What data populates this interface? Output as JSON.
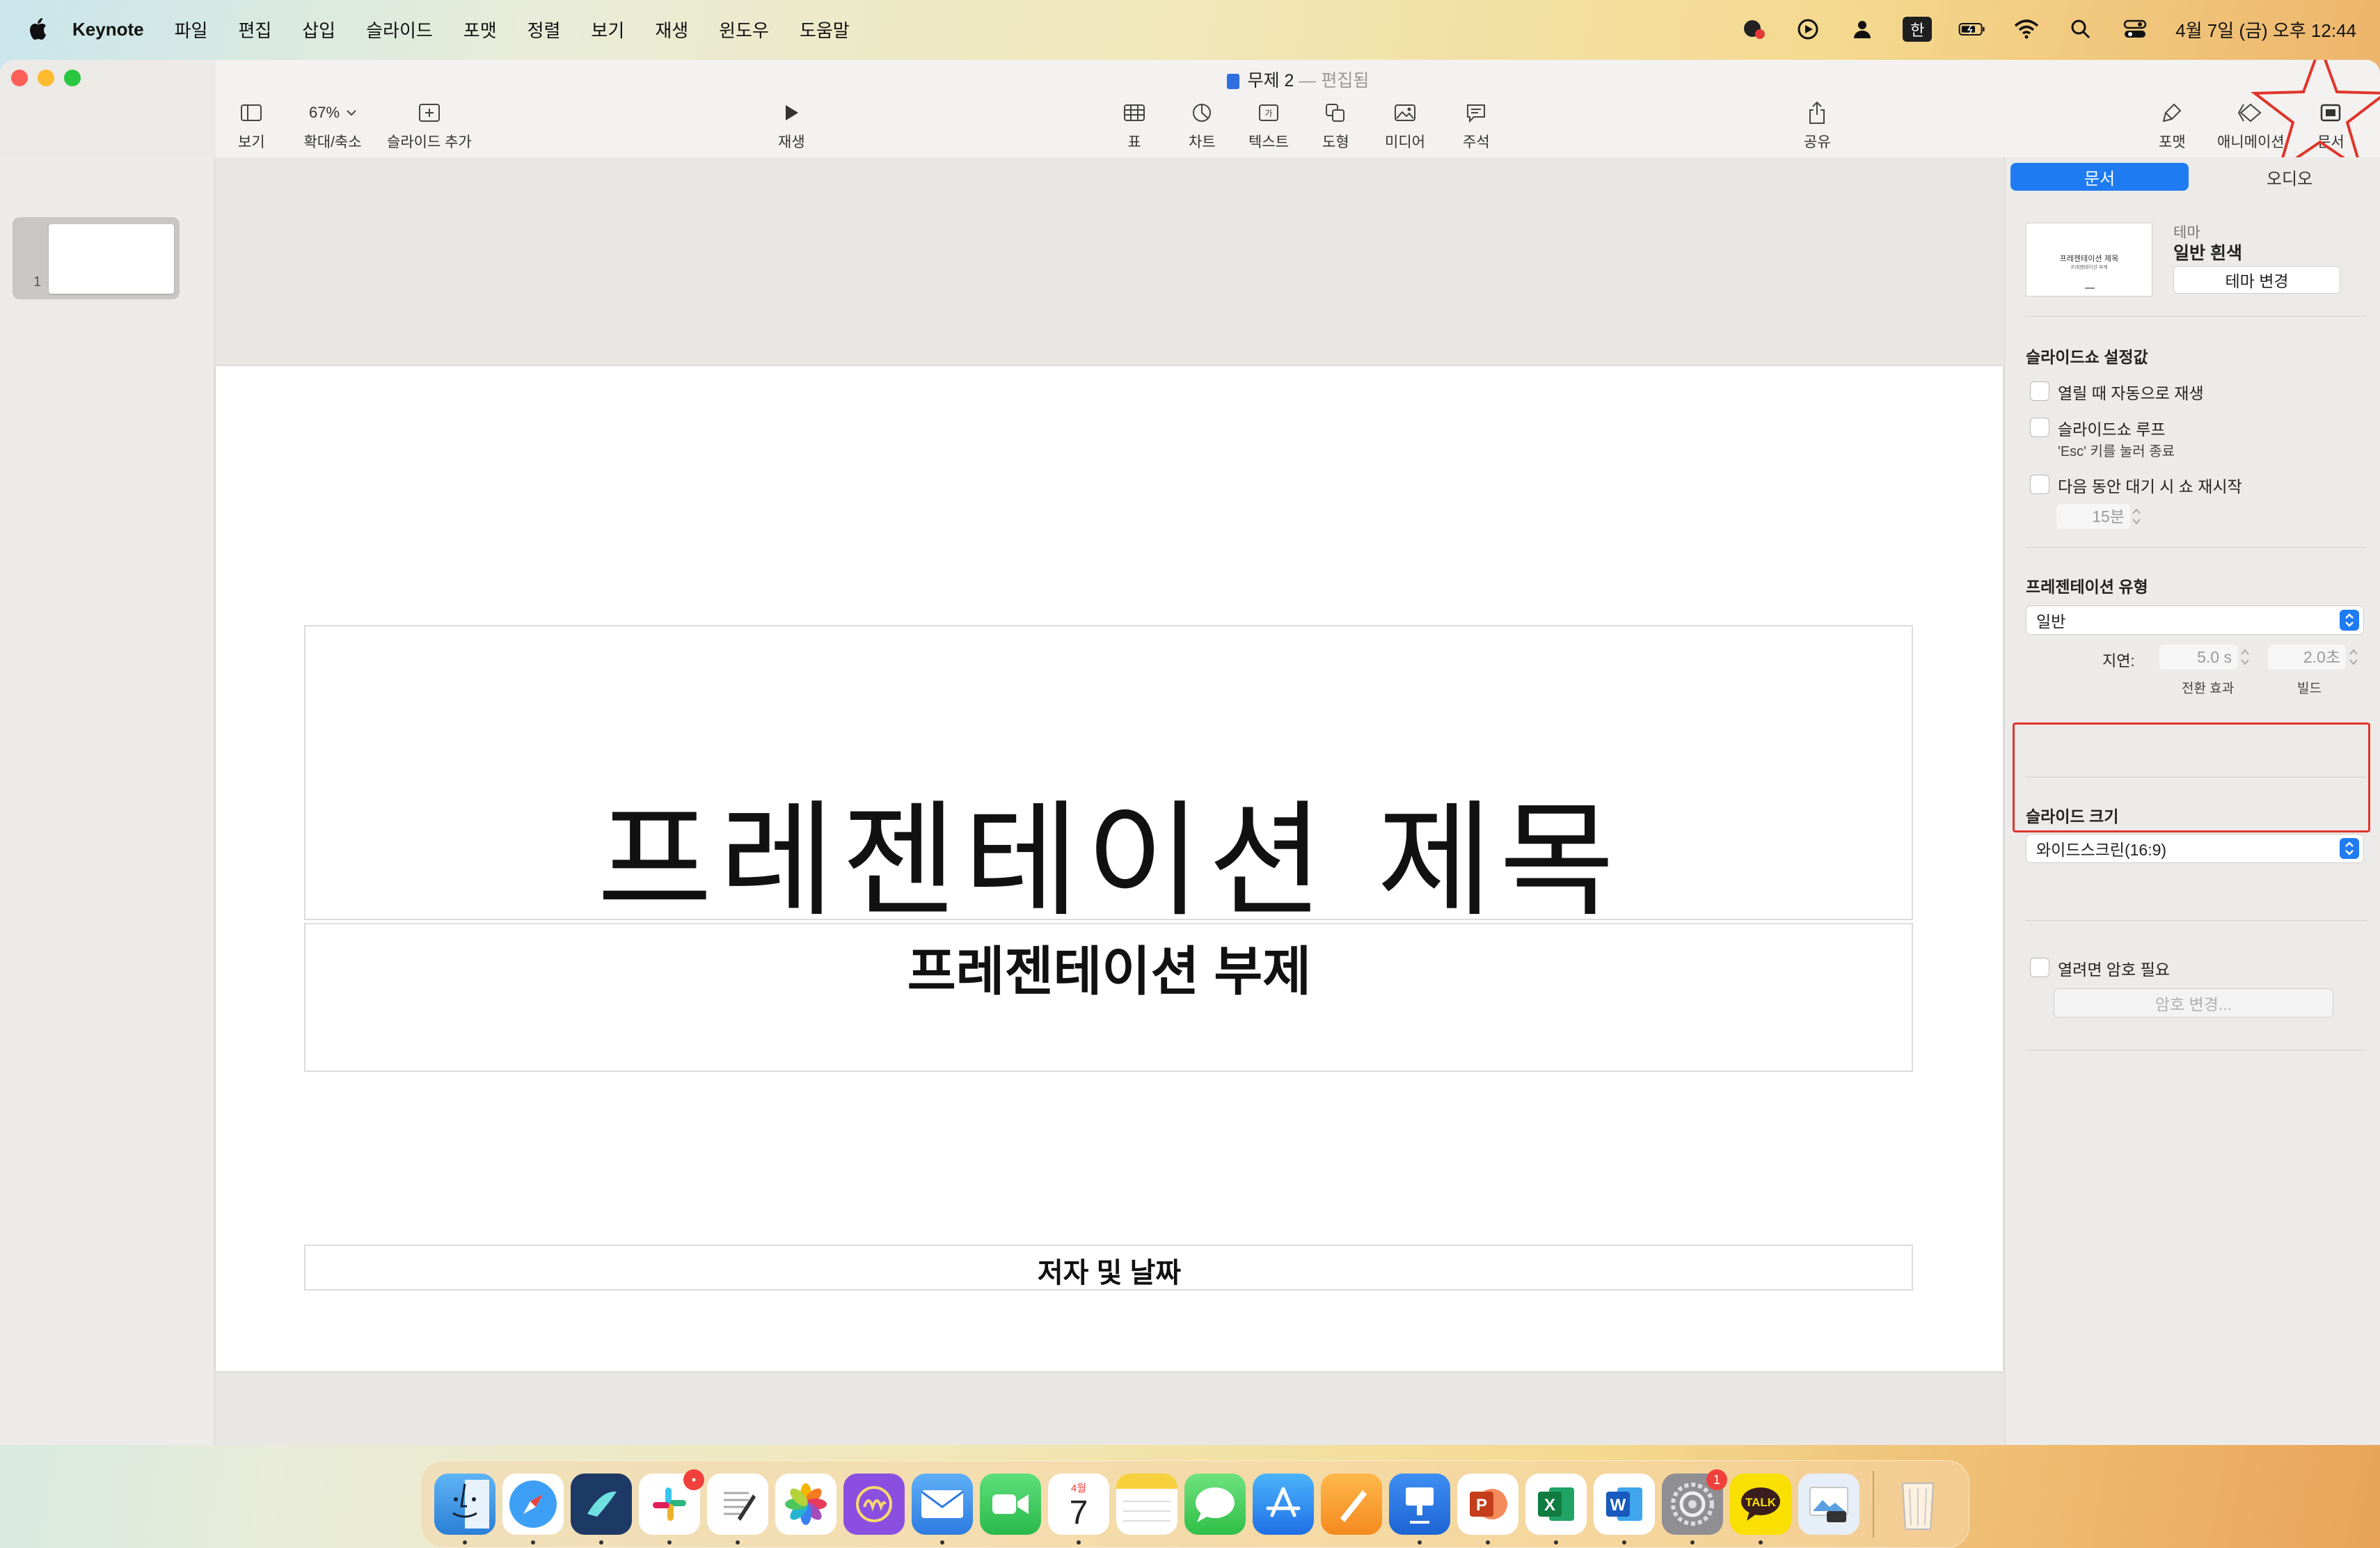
{
  "menubar": {
    "app_name": "Keynote",
    "items": [
      "파일",
      "편집",
      "삽입",
      "슬라이드",
      "포맷",
      "정렬",
      "보기",
      "재생",
      "윈도우",
      "도움말"
    ],
    "input_method": "한",
    "clock": "4월 7일 (금) 오후 12:44"
  },
  "window": {
    "doc_name": "무제 2",
    "doc_separator": "—",
    "doc_status": "편집됨"
  },
  "toolbar": {
    "view": "보기",
    "zoom_value": "67%",
    "zoom": "확대/축소",
    "add_slide": "슬라이드 추가",
    "play": "재생",
    "table": "표",
    "chart": "차트",
    "text": "텍스트",
    "shape": "도형",
    "media": "미디어",
    "comment": "주석",
    "share": "공유",
    "format": "포맷",
    "animate": "애니메이션",
    "document": "문서"
  },
  "sidebar": {
    "slide_number": "1"
  },
  "slide": {
    "title": "프레젠테이션 제목",
    "subtitle": "프레젠테이션 부제",
    "author": "저자 및 날짜"
  },
  "inspector": {
    "tabs": {
      "document": "문서",
      "audio": "오디오"
    },
    "theme": {
      "label": "테마",
      "name": "일반 흰색",
      "change_button": "테마 변경",
      "thumb_title": "프레젠테이션 제목",
      "thumb_subtitle": "프레젠테이션 부제"
    },
    "slideshow": {
      "heading": "슬라이드쇼 설정값",
      "autoplay": "열릴 때 자동으로 재생",
      "loop": "슬라이드쇼 루프",
      "loop_hint": "'Esc' 키를 눌러 종료",
      "restart": "다음 동안 대기 시 쇼 재시작",
      "restart_value": "15분"
    },
    "presentation_type": {
      "heading": "프레젠테이션 유형",
      "value": "일반",
      "delay_label": "지연:",
      "transition_value": "5.0 s",
      "build_value": "2.0초",
      "transition_label": "전환 효과",
      "build_label": "빌드"
    },
    "slide_size": {
      "heading": "슬라이드 크기",
      "value": "와이드스크린(16:9)"
    },
    "password": {
      "require": "열려면 암호 필요",
      "change_button": "암호 변경..."
    }
  },
  "dock": {
    "apps": [
      "finder-icon",
      "safari-icon",
      "app-icon",
      "slack-icon",
      "textedit-icon",
      "photos-icon",
      "app-icon",
      "mail-icon",
      "facetime-icon",
      "calendar-icon",
      "notes-icon",
      "messages-icon",
      "app-store-icon",
      "pages-icon",
      "keynote-icon",
      "powerpoint-icon",
      "excel-icon",
      "word-icon",
      "system-settings-icon",
      "kakaotalk-icon",
      "preview-icon",
      "trash-icon"
    ],
    "calendar_month": "4월",
    "calendar_day": "7",
    "talk_label": "TALK",
    "settings_badge": "1"
  },
  "colors": {
    "accent": "#1f7bf2",
    "highlight": "#e0352b"
  }
}
